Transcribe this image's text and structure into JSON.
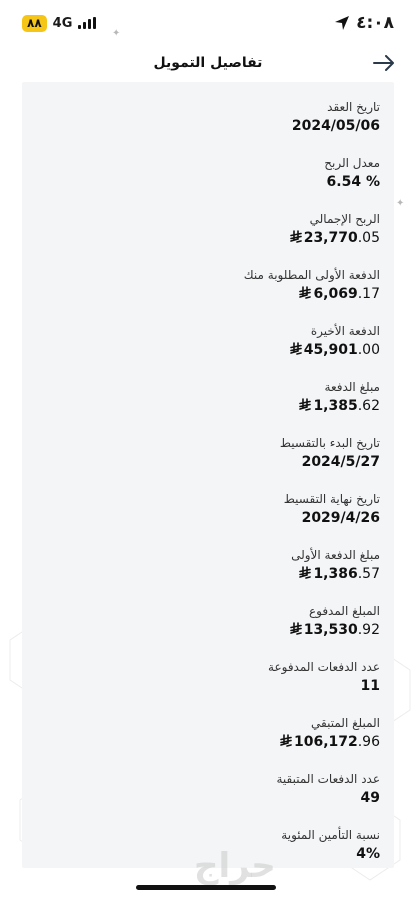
{
  "status_bar": {
    "battery": "٨٨",
    "network": "4G",
    "time": "٤:٠٨"
  },
  "header": {
    "title": "تفاصيل التمويل"
  },
  "details": [
    {
      "label": "تاريخ العقد",
      "value": "2024/05/06",
      "currency": false
    },
    {
      "label": "معدل الربح",
      "value": "6.54 %",
      "currency": false
    },
    {
      "label": "الربح الإجمالي",
      "int": "23,770",
      "dec": ".05",
      "currency": true
    },
    {
      "label": "الدفعة الأولى المطلوبة منك",
      "int": "6,069",
      "dec": ".17",
      "currency": true
    },
    {
      "label": "الدفعة الأخيرة",
      "int": "45,901",
      "dec": ".00",
      "currency": true
    },
    {
      "label": "مبلغ الدفعة",
      "int": "1,385",
      "dec": ".62",
      "currency": true
    },
    {
      "label": "تاريخ البدء بالتقسيط",
      "value": "2024/5/27",
      "currency": false
    },
    {
      "label": "تاريخ نهاية التقسيط",
      "value": "2029/4/26",
      "currency": false
    },
    {
      "label": "مبلغ الدفعة الأولى",
      "int": "1,386",
      "dec": ".57",
      "currency": true
    },
    {
      "label": "المبلغ المدفوع",
      "int": "13,530",
      "dec": ".92",
      "currency": true
    },
    {
      "label": "عدد الدفعات المدفوعة",
      "value": "11",
      "currency": false
    },
    {
      "label": "المبلغ المتبقي",
      "int": "106,172",
      "dec": ".96",
      "currency": true
    },
    {
      "label": "عدد الدفعات المتبقية",
      "value": "49",
      "currency": false
    },
    {
      "label": "نسبة التأمين المئوية",
      "value": "4%",
      "currency": false
    }
  ],
  "currency_symbol": "⃁",
  "watermark": "حراج"
}
